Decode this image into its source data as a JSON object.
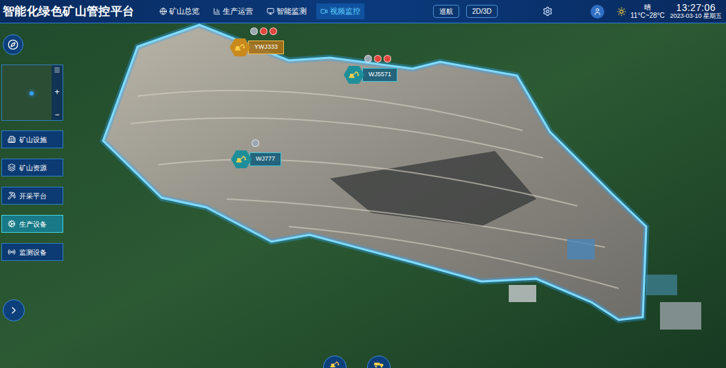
{
  "header": {
    "title": "智能化绿色矿山管控平台",
    "nav": [
      {
        "label": "矿山总览",
        "selected": false
      },
      {
        "label": "生产运营",
        "selected": false
      },
      {
        "label": "智能监测",
        "selected": false
      },
      {
        "label": "视频监控",
        "selected": true
      }
    ],
    "buttons": [
      "巡航",
      "2D/3D"
    ],
    "weather": {
      "condition": "晴",
      "range": "11°C~28°C"
    },
    "time": "13:27:06",
    "date": "2023-03-10 星期五"
  },
  "minimap": {
    "zoom_in": "+",
    "zoom_out": "−"
  },
  "sidebar": {
    "items": [
      {
        "label": "矿山设施",
        "selected": false
      },
      {
        "label": "矿山资源",
        "selected": false
      },
      {
        "label": "开采平台",
        "selected": false
      },
      {
        "label": "生产设备",
        "selected": true
      },
      {
        "label": "监测设备",
        "selected": false
      }
    ]
  },
  "markers": [
    {
      "label": "YWJ333",
      "highlighted": true,
      "warning": true
    },
    {
      "label": "WJ5571",
      "highlighted": false,
      "warning": true
    },
    {
      "label": "WJ777",
      "highlighted": false,
      "warning": false
    }
  ]
}
